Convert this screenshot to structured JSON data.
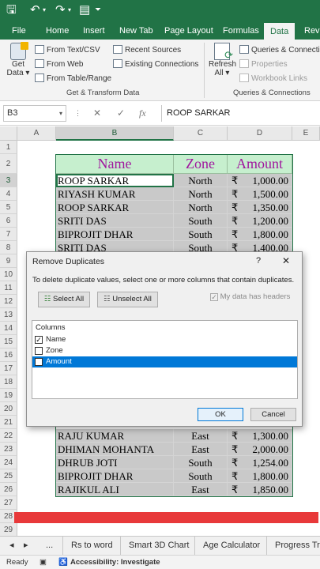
{
  "ribbon_tabs": [
    "File",
    "Home",
    "Insert",
    "New Tab",
    "Page Layout",
    "Formulas",
    "Data",
    "Revie"
  ],
  "active_tab": "Data",
  "ribbon": {
    "get_data": [
      "Get",
      "Data ▾"
    ],
    "from_text": "From Text/CSV",
    "from_web": "From Web",
    "from_table": "From Table/Range",
    "recent_sources": "Recent Sources",
    "existing_connections": "Existing Connections",
    "group1_label": "Get & Transform Data",
    "refresh_all": [
      "Refresh",
      "All ▾"
    ],
    "queries_connections": "Queries & Connectio",
    "properties": "Properties",
    "workbook_links": "Workbook Links",
    "group2_label": "Queries & Connections"
  },
  "formula_bar": {
    "name_box": "B3",
    "fx": "fx",
    "content": "ROOP SARKAR"
  },
  "columns": [
    "A",
    "B",
    "C",
    "D",
    "E"
  ],
  "headers": {
    "name": "Name",
    "zone": "Zone",
    "amount": "Amount"
  },
  "rows_top": [
    {
      "row": "3",
      "name": "ROOP SARKAR",
      "zone": "North",
      "amount": "1,000.00"
    },
    {
      "row": "4",
      "name": "RIYASH KUMAR",
      "zone": "North",
      "amount": "1,500.00"
    },
    {
      "row": "5",
      "name": "ROOP SARKAR",
      "zone": "North",
      "amount": "1,350.00"
    },
    {
      "row": "6",
      "name": "SRITI DAS",
      "zone": "South",
      "amount": "1,200.00"
    },
    {
      "row": "7",
      "name": "BIPROJIT DHAR",
      "zone": "South",
      "amount": "1,800.00"
    },
    {
      "row": "8",
      "name": "SRITI DAS",
      "zone": "South",
      "amount": "1,400.00"
    }
  ],
  "rows_bottom": [
    {
      "row": "22",
      "name": "RAJU KUMAR",
      "zone": "East",
      "amount": "1,300.00"
    },
    {
      "row": "23",
      "name": "DHIMAN MOHANTA",
      "zone": "East",
      "amount": "2,000.00"
    },
    {
      "row": "24",
      "name": "DHRUB JOTI",
      "zone": "South",
      "amount": "1,254.00"
    },
    {
      "row": "25",
      "name": "BIPROJIT DHAR",
      "zone": "South",
      "amount": "1,800.00"
    },
    {
      "row": "26",
      "name": "RAJIKUL ALI",
      "zone": "East",
      "amount": "1,850.00"
    }
  ],
  "currency": "₹",
  "row_numbers": [
    "1",
    "2",
    "3",
    "4",
    "5",
    "6",
    "7",
    "8",
    "9",
    "10",
    "11",
    "12",
    "13",
    "14",
    "15",
    "16",
    "17",
    "18",
    "19",
    "20",
    "21",
    "22",
    "23",
    "24",
    "25",
    "26",
    "27",
    "28",
    "29"
  ],
  "dialog": {
    "title": "Remove Duplicates",
    "help": "?",
    "close": "✕",
    "instruction": "To delete duplicate values, select one or more columns that contain duplicates.",
    "select_all": "Select All",
    "unselect_all": "Unselect All",
    "my_data_headers": "My data has headers",
    "columns_label": "Columns",
    "items": [
      {
        "label": "Name",
        "checked": true
      },
      {
        "label": "Zone",
        "checked": false
      },
      {
        "label": "Amount",
        "checked": false
      }
    ],
    "ok": "OK",
    "cancel": "Cancel"
  },
  "sheet_tabs": [
    "Rs to word",
    "Smart 3D Chart",
    "Age Calculator",
    "Progress Tra"
  ],
  "status": {
    "ready": "Ready",
    "accessibility": "Accessibility: Investigate"
  },
  "colors": {
    "excel_green": "#217346",
    "header_fill": "#c6efce",
    "header_text": "#a0169e",
    "selection": "#0078d7",
    "red_bar": "#e8393a"
  }
}
